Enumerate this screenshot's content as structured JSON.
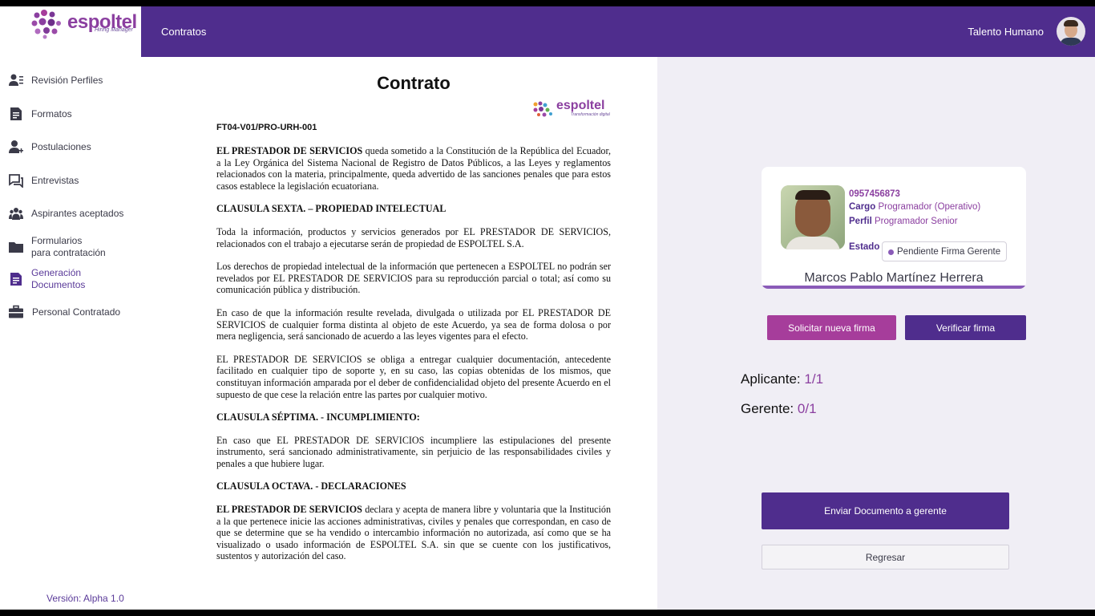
{
  "app": {
    "logo_text": "espoltel",
    "logo_subtitle": "Hiring Manager",
    "section_title": "Contratos",
    "user_role": "Talento Humano",
    "version": "Versión: Alpha 1.0"
  },
  "sidebar": {
    "items": [
      {
        "label": "Revisión Perfiles",
        "icon": "user-list-icon"
      },
      {
        "label": "Formatos",
        "icon": "document-icon"
      },
      {
        "label": "Postulaciones",
        "icon": "user-add-icon"
      },
      {
        "label": "Entrevistas",
        "icon": "chat-icon"
      },
      {
        "label": "Aspirantes aceptados",
        "icon": "group-icon"
      },
      {
        "label": "Formularios\npara contratación",
        "icon": "folder-icon"
      },
      {
        "label": "Generación\nDocumentos",
        "icon": "document-edit-icon"
      },
      {
        "label": "Personal Contratado",
        "icon": "briefcase-icon"
      }
    ]
  },
  "document": {
    "title": "Contrato",
    "logo_text": "espoltel",
    "logo_sub": "Transformación digital",
    "code": "FT04-V01/PRO-URH-001",
    "paragraphs": [
      {
        "bold": "EL PRESTADOR DE SERVICIOS",
        "text": " queda sometido a la Constitución de la República del Ecuador, a la Ley Orgánica del Sistema Nacional de Registro de Datos Públicos, a las Leyes y reglamentos relacionados con la materia, principalmente, queda advertido de las sanciones penales que para estos casos establece la legislación ecuatoriana."
      },
      {
        "heading": "CLAUSULA SEXTA. – PROPIEDAD INTELECTUAL"
      },
      {
        "text": "Toda la información, productos y servicios generados por EL PRESTADOR DE SERVICIOS, relacionados con el trabajo a ejecutarse serán de propiedad de ESPOLTEL S.A."
      },
      {
        "text": "Los derechos de propiedad intelectual de la información que pertenecen a ESPOLTEL no podrán ser revelados por EL PRESTADOR DE SERVICIOS para su reproducción parcial o total; así como su comunicación pública y distribución."
      },
      {
        "text": "En caso de que la información resulte revelada, divulgada o utilizada por EL PRESTADOR DE SERVICIOS de cualquier forma distinta al objeto de este Acuerdo, ya sea de forma dolosa o por mera negligencia, será sancionado de acuerdo a las leyes vigentes para el efecto."
      },
      {
        "text": "EL PRESTADOR DE SERVICIOS se obliga a entregar cualquier documentación, antecedente facilitado en cualquier tipo de soporte y, en su caso, las copias obtenidas de los mismos, que constituyan información amparada por el deber de confidencialidad objeto del presente Acuerdo en el supuesto de que cese la relación entre las partes por cualquier motivo."
      },
      {
        "heading": "CLAUSULA SÉPTIMA. - INCUMPLIMIENTO:"
      },
      {
        "text": "En caso que EL PRESTADOR DE SERVICIOS incumpliere las estipulaciones del presente instrumento, será sancionado administrativamente, sin perjuicio de las responsabilidades civiles y penales a que hubiere lugar."
      },
      {
        "heading": "CLAUSULA OCTAVA. - DECLARACIONES"
      },
      {
        "bold": "EL PRESTADOR DE SERVICIOS",
        "text": " declara y acepta de manera libre y voluntaria que la Institución a la que pertenece inicie las acciones administrativas, civiles y penales que correspondan, en caso de que se determine que se ha vendido o intercambio información no autorizada, así como que se ha visualizado o usado información de ESPOLTEL S.A. sin que se cuente con los justificativos, sustentos y autorización del caso."
      }
    ]
  },
  "candidate": {
    "id": "0957456873",
    "cargo_label": "Cargo",
    "cargo_value": "Programador (Operativo)",
    "perfil_label": "Perfil",
    "perfil_value": "Programador Senior",
    "estado_label": "Estado",
    "estado_value": "Pendiente Firma Gerente",
    "name": "Marcos Pablo Martínez Herrera"
  },
  "actions": {
    "solicitar": "Solicitar nueva firma",
    "verificar": "Verificar firma",
    "enviar": "Enviar Documento a gerente",
    "regresar": "Regresar"
  },
  "signatures": {
    "aplicante_label": "Aplicante:",
    "aplicante_value": "1/1",
    "gerente_label": "Gerente:",
    "gerente_value": "0/1"
  },
  "colors": {
    "primary": "#4f2d8d",
    "accent": "#a63d9b",
    "link": "#8b3fa0"
  }
}
